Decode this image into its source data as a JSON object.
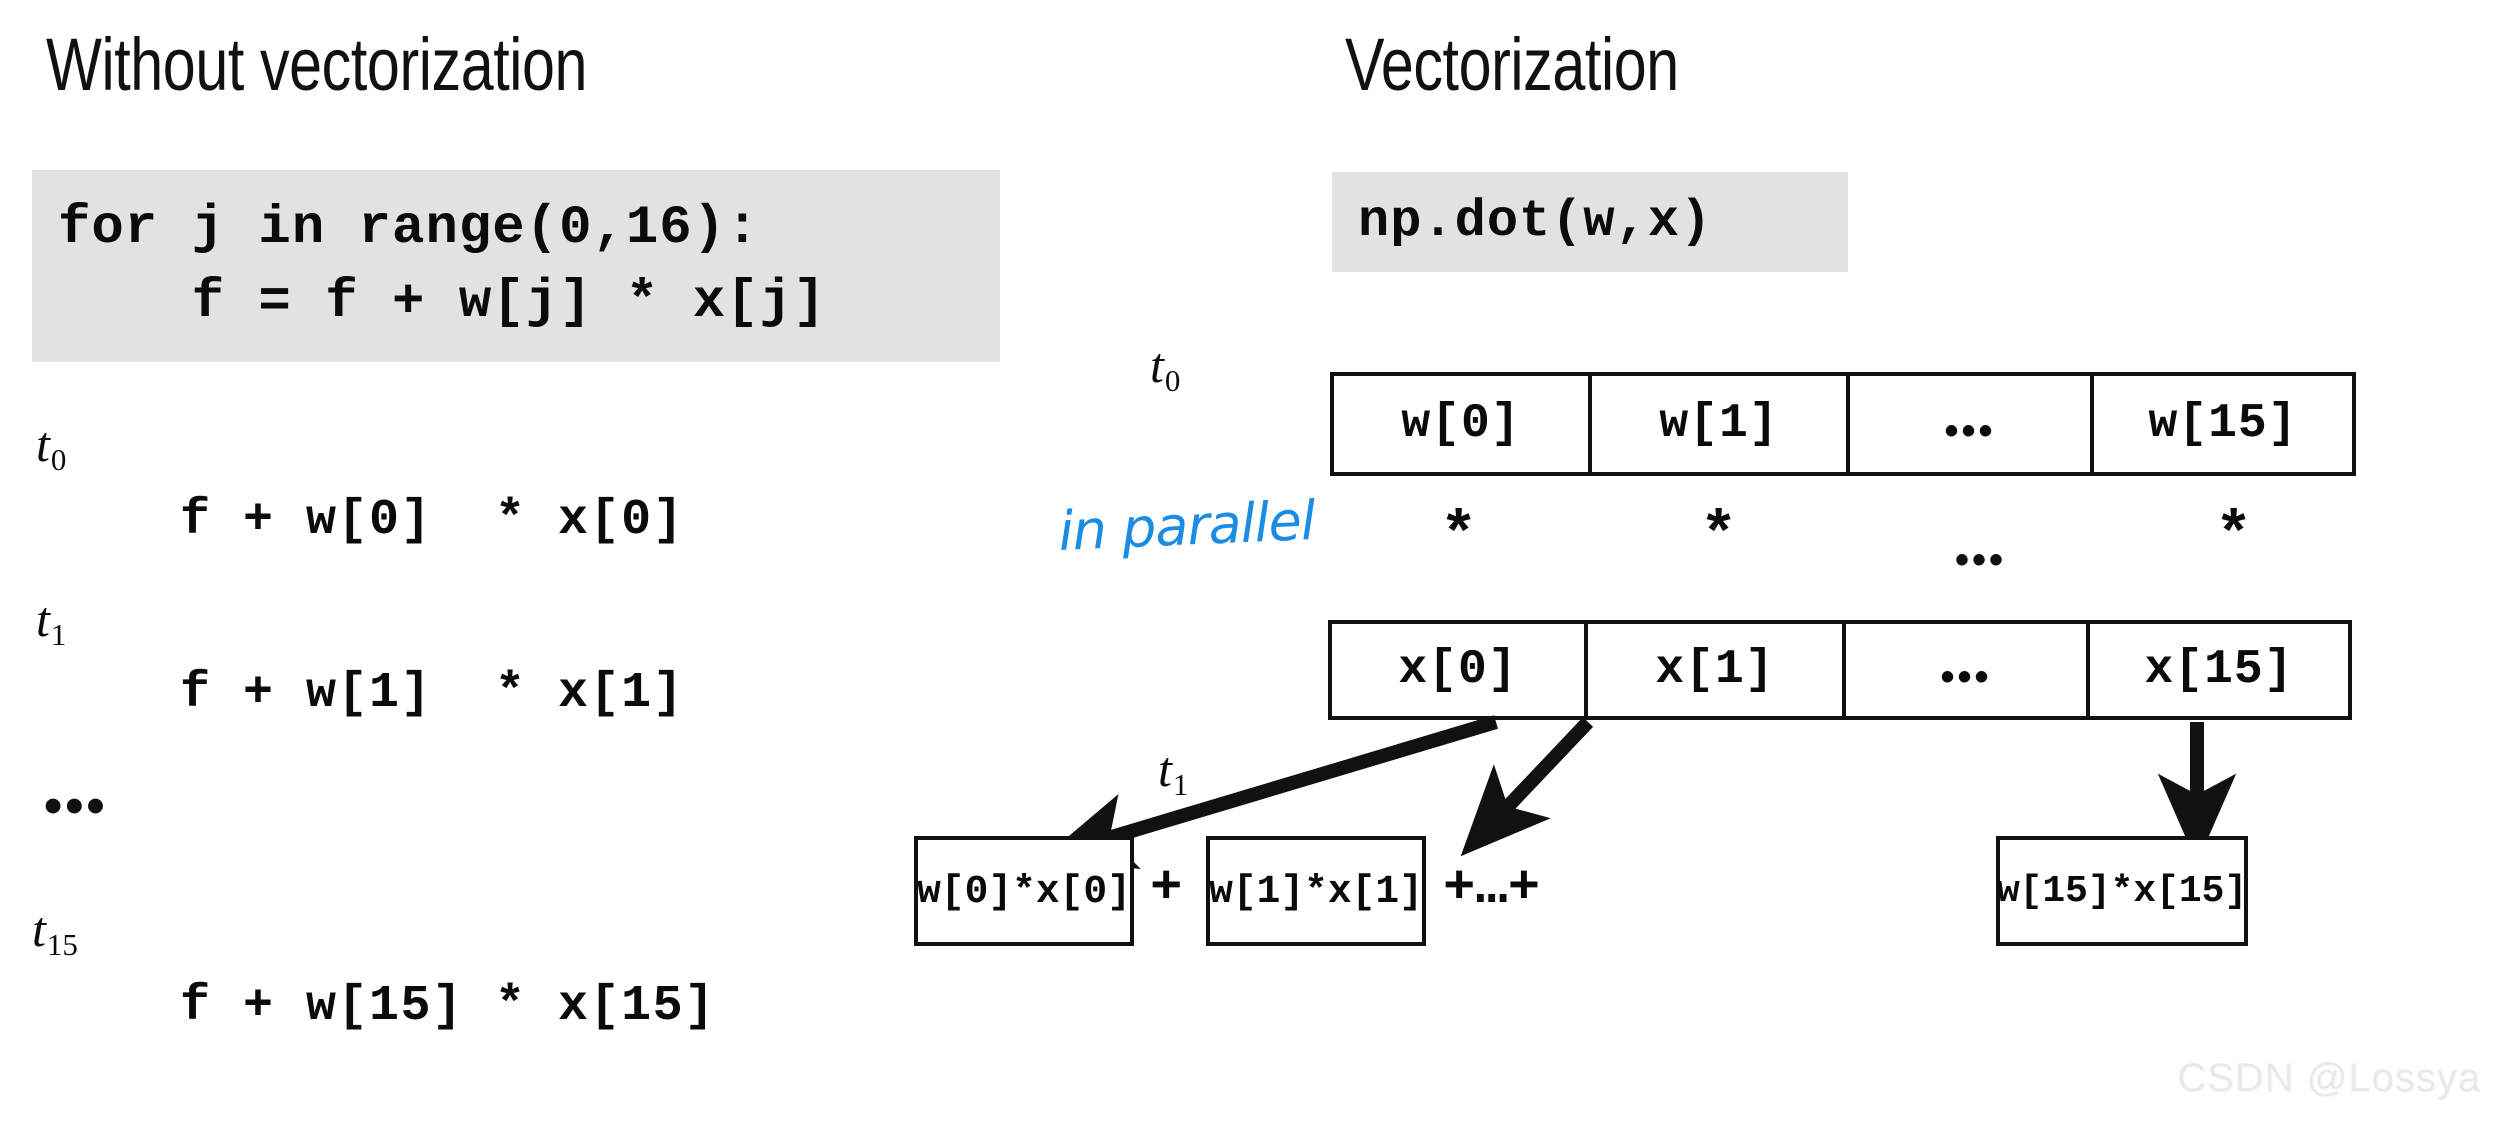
{
  "left_panel": {
    "heading": "Without vectorization",
    "code_block": "for j in range(0,16):\n    f = f + w[j] * x[j]",
    "timeline": [
      {
        "time_base": "t",
        "time_sub": "0",
        "expr": "f + w[0]  * x[0]"
      },
      {
        "time_base": "t",
        "time_sub": "1",
        "expr": "f + w[1]  * x[1]"
      },
      {
        "ellipsis": "•••"
      },
      {
        "time_base": "t",
        "time_sub": "15",
        "expr": "f + w[15] * x[15]"
      }
    ]
  },
  "right_panel": {
    "heading": "Vectorization",
    "code_block": "np.dot(w,x)",
    "w_time_label": {
      "base": "t",
      "sub": "0"
    },
    "x_time_label": {
      "base": "t",
      "sub": "1"
    },
    "w_vector": [
      "w[0]",
      "w[1]",
      "•••",
      "w[15]"
    ],
    "x_vector": [
      "x[0]",
      "x[1]",
      "•••",
      "x[15]"
    ],
    "operator_row": {
      "annotation": "in parallel",
      "annotation_color": "#1b8ce3",
      "operators": [
        "*",
        "*",
        "*"
      ],
      "ellipsis": "•••"
    },
    "products": [
      "w[0]*x[0]",
      "w[1]*x[1]",
      "w[15]*x[15]"
    ],
    "separators": [
      "+",
      "+…+"
    ]
  },
  "watermark": "CSDN @Lossya"
}
